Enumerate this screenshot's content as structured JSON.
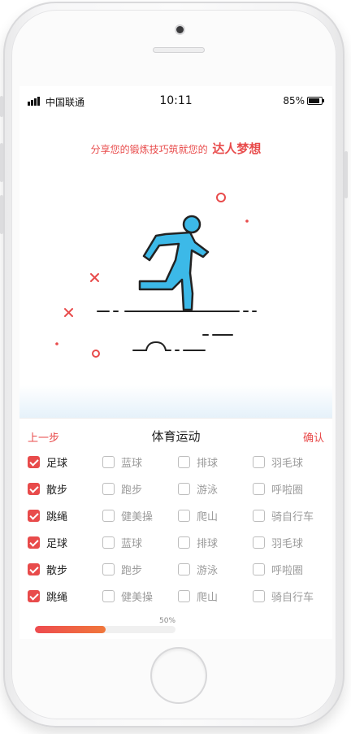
{
  "status_bar": {
    "carrier": "中国联通",
    "time": "10:11",
    "battery": "85%",
    "battery_level": 0.85
  },
  "banner": {
    "slogan_prefix": "分享您的锻炼技巧筑就您的",
    "slogan_highlight": "达人梦想",
    "illustration_icon": "running-man-icon"
  },
  "header": {
    "prev_label": "上一步",
    "title": "体育运动",
    "confirm_label": "确认"
  },
  "options": [
    [
      {
        "label": "足球",
        "checked": true
      },
      {
        "label": "蓝球",
        "checked": false
      },
      {
        "label": "排球",
        "checked": false
      },
      {
        "label": "羽毛球",
        "checked": false
      }
    ],
    [
      {
        "label": "散步",
        "checked": true
      },
      {
        "label": "跑步",
        "checked": false
      },
      {
        "label": "游泳",
        "checked": false
      },
      {
        "label": "呼啦圈",
        "checked": false
      }
    ],
    [
      {
        "label": "跳绳",
        "checked": true
      },
      {
        "label": "健美操",
        "checked": false
      },
      {
        "label": "爬山",
        "checked": false
      },
      {
        "label": "骑自行车",
        "checked": false
      }
    ],
    [
      {
        "label": "足球",
        "checked": true
      },
      {
        "label": "蓝球",
        "checked": false
      },
      {
        "label": "排球",
        "checked": false
      },
      {
        "label": "羽毛球",
        "checked": false
      }
    ],
    [
      {
        "label": "散步",
        "checked": true
      },
      {
        "label": "跑步",
        "checked": false
      },
      {
        "label": "游泳",
        "checked": false
      },
      {
        "label": "呼啦圈",
        "checked": false
      }
    ],
    [
      {
        "label": "跳绳",
        "checked": true
      },
      {
        "label": "健美操",
        "checked": false
      },
      {
        "label": "爬山",
        "checked": false
      },
      {
        "label": "骑自行车",
        "checked": false
      }
    ]
  ],
  "progress": {
    "label": "50%",
    "value": 0.5
  },
  "colors": {
    "accent": "#e84b4b",
    "runner": "#3cb9e8",
    "progress_start": "#ee4b4f",
    "progress_end": "#f0773b"
  }
}
